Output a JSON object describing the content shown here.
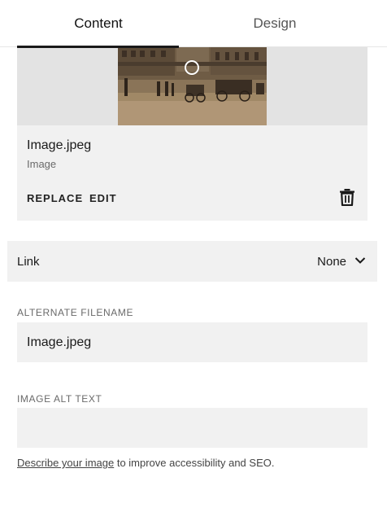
{
  "tabs": [
    {
      "label": "Content",
      "active": true
    },
    {
      "label": "Design",
      "active": false
    }
  ],
  "image": {
    "filename": "Image.jpeg",
    "type": "Image",
    "replace_label": "REPLACE",
    "edit_label": "EDIT"
  },
  "link": {
    "label": "Link",
    "value": "None"
  },
  "alt_filename": {
    "label": "ALTERNATE FILENAME",
    "value": "Image.jpeg"
  },
  "alt_text": {
    "label": "IMAGE ALT TEXT",
    "value": "",
    "help_link": "Describe your image",
    "help_text": " to improve accessibility and SEO."
  },
  "colors": {
    "panel_bg": "#f1f1f1",
    "accent": "#1a1a1a",
    "muted_text": "#6a6a6a"
  }
}
